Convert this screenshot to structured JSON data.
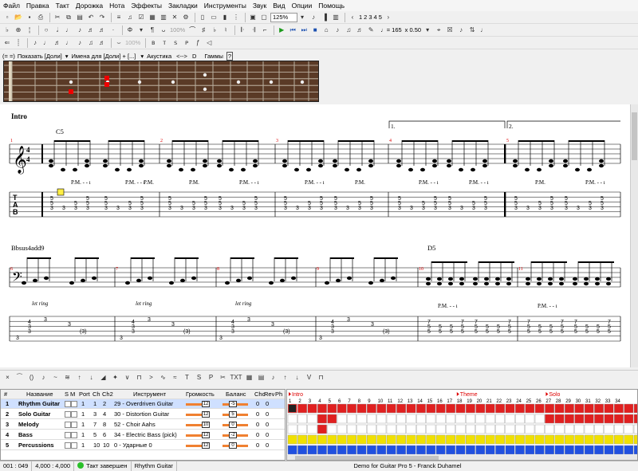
{
  "menu": [
    "Файл",
    "Правка",
    "Такт",
    "Дорожка",
    "Нота",
    "Эффекты",
    "Закладки",
    "Инструменты",
    "Звук",
    "Вид",
    "Опции",
    "Помощь"
  ],
  "toolbar1": {
    "zoom": "125%",
    "pages": [
      "1",
      "2",
      "3",
      "4",
      "5"
    ]
  },
  "toolbar2": {
    "tempo": "♩= 165",
    "speed": "x 0.50",
    "percent": "100%"
  },
  "fretbar": {
    "show_label": "Показать [Доли]",
    "names_label": "Имена для [Доли] + [...]",
    "acoustic": "Акустика",
    "arrows": "<-->",
    "key": "D",
    "scales": "Гаммы"
  },
  "score": {
    "section_intro": "Intro",
    "chord_c5": "C5",
    "chord_bb": "Bbsus4add9",
    "chord_d5": "D5",
    "volta1": "1.",
    "volta2": "2.",
    "pm_labels": [
      "P.M. - - ı",
      "P.M. - - ı",
      "P.M.",
      "P.M. - - ı",
      "P.M. - - ı",
      "P.M.",
      "P.M. - - ı",
      "P.M. - - ı",
      "P.M.",
      "P.M. - - ı",
      "P.M. - - ı",
      "P.M.",
      "P.M. - - ı",
      "P.M. - - ı"
    ],
    "letring": [
      "let ring",
      "let ring",
      "let ring"
    ],
    "measure_numbers": [
      "1",
      "2",
      "3",
      "4",
      "5",
      "6",
      "7",
      "8",
      "9",
      "10",
      "11"
    ]
  },
  "tracks_header": {
    "num": "#",
    "name": "Название",
    "s": "S",
    "m": "M",
    "port": "Port",
    "ch": "Ch",
    "ch2": "Ch2",
    "instrument": "Инструмент",
    "volume": "Громкость",
    "balance": "Баланс",
    "cho": "Cho",
    "rev": "Rev",
    "ph": "Ph"
  },
  "tracks": [
    {
      "num": "1",
      "name": "Rhythm Guitar",
      "port": "1",
      "ch": "1",
      "ch2": "2",
      "instrument": "29 - Overdriven Guitar",
      "vol": "12",
      "bal": "-5",
      "cho": "0",
      "rev": "0"
    },
    {
      "num": "2",
      "name": "Solo Guitar",
      "port": "1",
      "ch": "3",
      "ch2": "4",
      "instrument": "30 - Distortion Guitar",
      "vol": "12",
      "bal": "5",
      "cho": "0",
      "rev": "0"
    },
    {
      "num": "3",
      "name": "Melody",
      "port": "1",
      "ch": "7",
      "ch2": "8",
      "instrument": "52 - Choir Aahs",
      "vol": "10",
      "bal": "0",
      "cho": "0",
      "rev": "0"
    },
    {
      "num": "4",
      "name": "Bass",
      "port": "1",
      "ch": "5",
      "ch2": "6",
      "instrument": "34 - Electric Bass (pick)",
      "vol": "12",
      "bal": "-2",
      "cho": "0",
      "rev": "0"
    },
    {
      "num": "5",
      "name": "Percussions",
      "port": "1",
      "ch": "10",
      "ch2": "10",
      "instrument": "0 - Ударные 0",
      "vol": "12",
      "bal": "0",
      "cho": "0",
      "rev": "0"
    }
  ],
  "timeline": {
    "markers": [
      "Intro",
      "Theme",
      "Solo"
    ],
    "bar_numbers": [
      "1",
      "2",
      "3",
      "4",
      "5",
      "6",
      "7",
      "8",
      "9",
      "10",
      "11",
      "12",
      "13",
      "14",
      "15",
      "16",
      "17",
      "18",
      "19",
      "20",
      "21",
      "22",
      "23",
      "24",
      "25",
      "26",
      "27",
      "28",
      "29",
      "30",
      "31",
      "32",
      "33",
      "34"
    ],
    "colors": {
      "rhythm": "#e02020",
      "melody": "#e02020",
      "bass": "#f0e000",
      "perc": "#2050e0"
    }
  },
  "status": {
    "position": "001 : 049",
    "time": "4,000 : 4,000",
    "bar_state": "Такт завершен",
    "track": "Rhythm Guitar",
    "song": "Demo for Guitar Pro 5 - Franck Duhamel"
  }
}
